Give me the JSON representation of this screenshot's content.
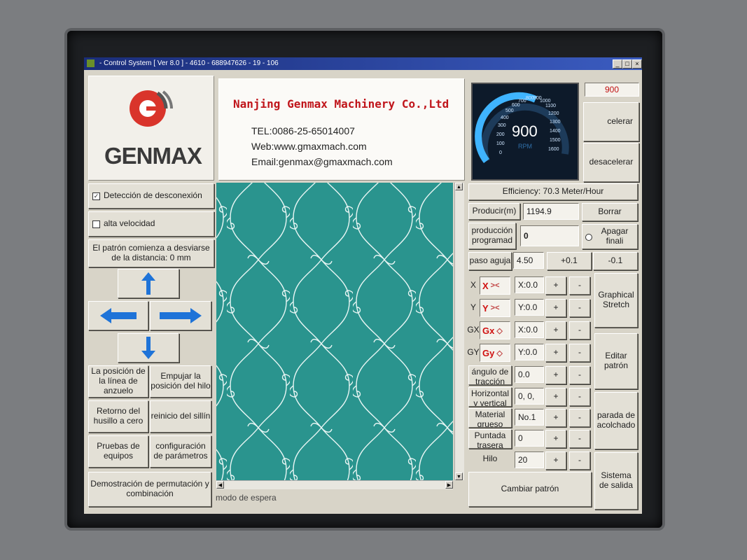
{
  "window": {
    "title": "- Control System [ Ver 8.0 ] - 4610 - 688947626 - 19 - 106",
    "controls": [
      "_",
      "□",
      "×"
    ]
  },
  "logo": {
    "brand": "GENMAX"
  },
  "company": {
    "name": "Nanjing Genmax Machinery Co.,Ltd",
    "tel": "TEL:0086-25-65014007",
    "web": "Web:www.gmaxmach.com",
    "email": "Email:genmax@gmaxmach.com"
  },
  "gauge": {
    "value": "900",
    "unit": "RPM",
    "ticks": [
      "0",
      "100",
      "200",
      "300",
      "400",
      "500",
      "600",
      "700",
      "800",
      "900",
      "1000",
      "1100",
      "1200",
      "1300",
      "1400",
      "1500",
      "1600"
    ],
    "accent": "#3fb4ff"
  },
  "speed_display": "900",
  "speed_buttons": {
    "accelerate": "celerar",
    "decelerate": "desacelerar"
  },
  "left": {
    "disconnect_label": "Detección de desconexión",
    "disconnect_checked": true,
    "high_speed_label": "alta velocidad",
    "high_speed_checked": false,
    "deviation_text": "El patrón comienza a desviarse de la distancia: 0 mm",
    "grid": [
      "La posición de la línea de anzuelo",
      "Empujar la posición del hilo",
      "Retorno del husillo a cero",
      "reinicio del sillín",
      "Pruebas de equipos",
      "configuración de parámetros"
    ],
    "demo": "Demostración de permutación y combinación"
  },
  "right": {
    "efficiency": "Efficiency: 70.3 Meter/Hour",
    "produce_label": "Producir(m)",
    "produce_value": "1194.9",
    "clear": "Borrar",
    "planned_label": "producción programad",
    "planned_value": "0",
    "shutdown": "Apagar finali",
    "needle_label": "paso aguja",
    "needle_value": "4.50",
    "plus01": "+0.1",
    "minus01": "-0.1",
    "axes": [
      {
        "label": "X",
        "icon": "X",
        "value": "X:0.0"
      },
      {
        "label": "Y",
        "icon": "Y",
        "value": "Y:0.0"
      },
      {
        "label": "GX",
        "icon": "Gx",
        "value": "X:0.0"
      },
      {
        "label": "GY",
        "icon": "Gy",
        "value": "Y:0.0"
      }
    ],
    "params": [
      {
        "label": "ángulo de tracción",
        "value": "0.0"
      },
      {
        "label": "Horizontal y vertical",
        "value": "0, 0,"
      },
      {
        "label": "Material grueso",
        "value": "No.1"
      },
      {
        "label": "Puntada trasera",
        "value": "0"
      },
      {
        "label": "Hilo",
        "value": "20"
      }
    ],
    "plus": "+",
    "minus": "-",
    "side_buttons": [
      "Graphical Stretch",
      "Editar patrón",
      "parada de acolchado",
      "Sistema de salida"
    ],
    "change_pattern": "Cambiar patrón"
  },
  "status": "modo de espera"
}
